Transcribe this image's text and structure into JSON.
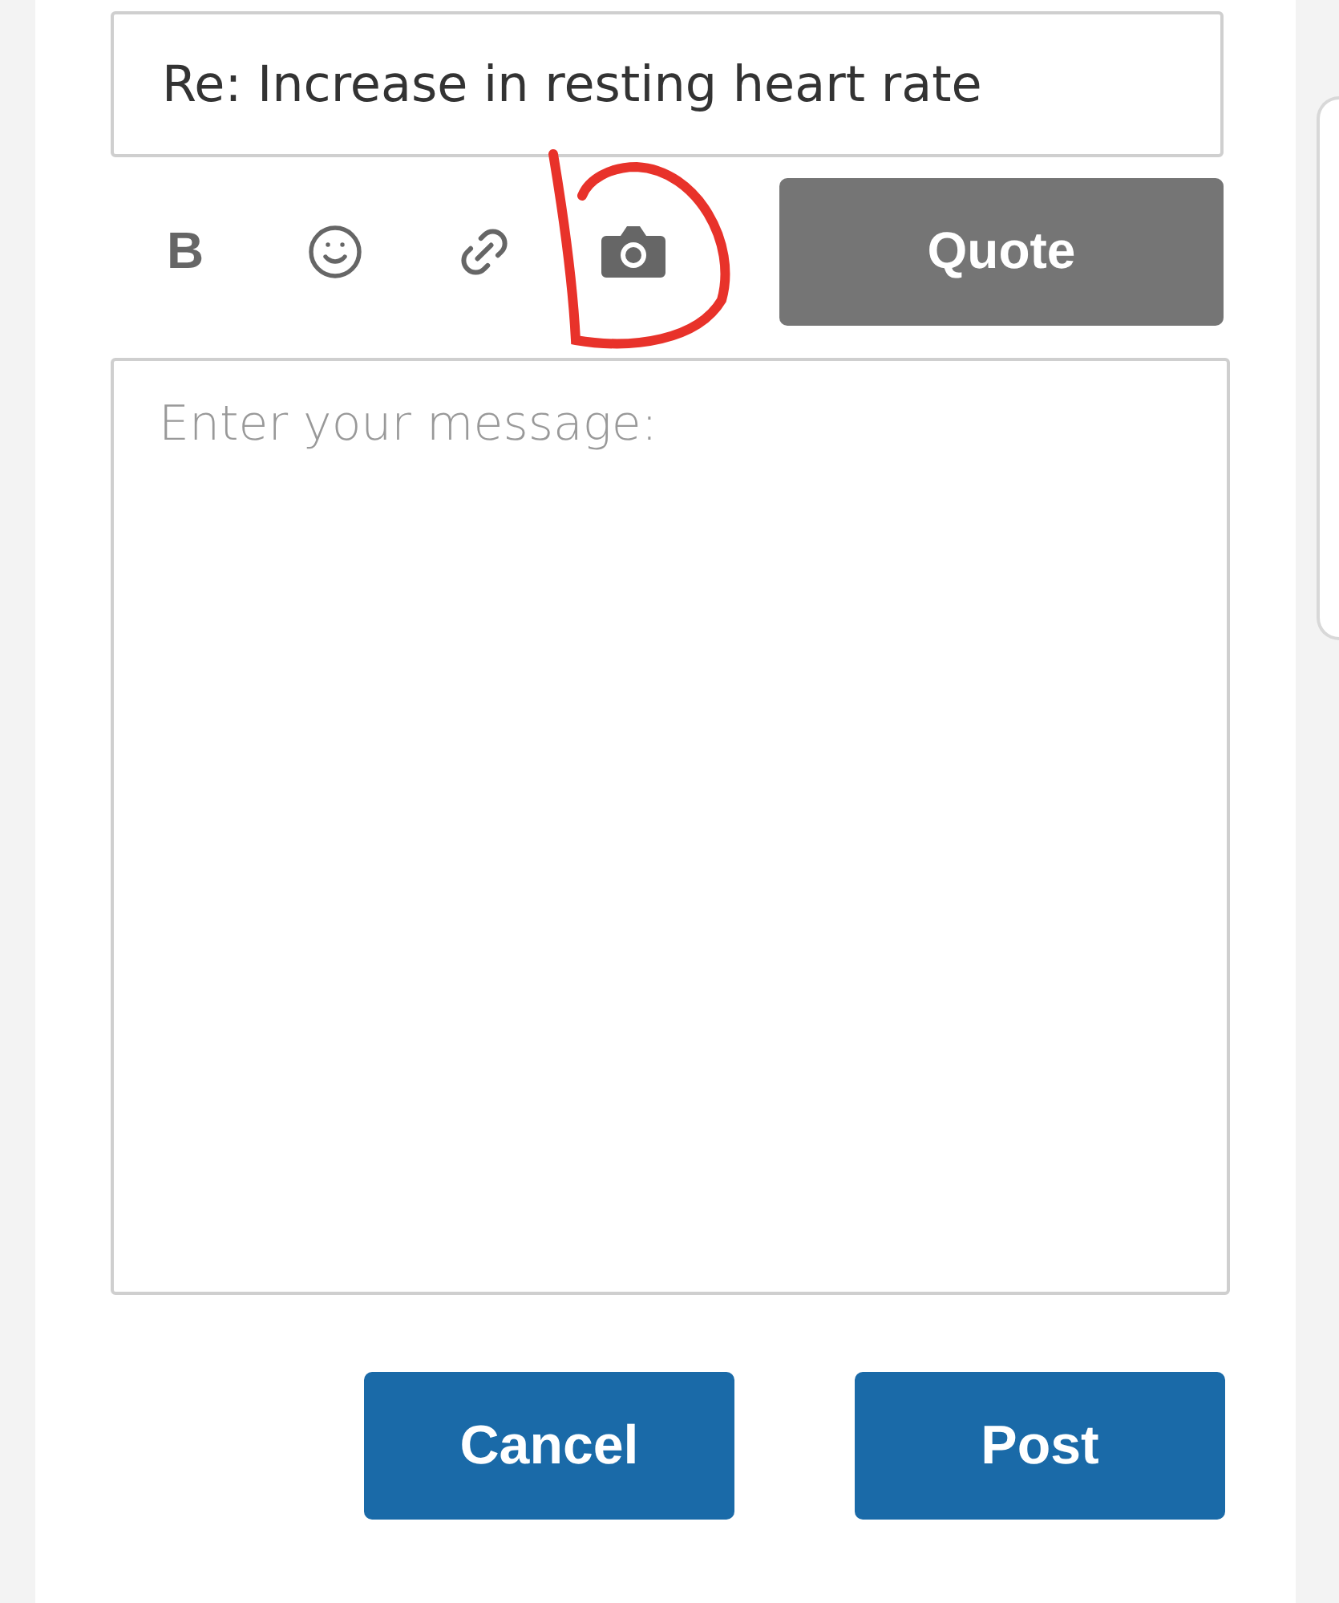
{
  "subject": {
    "value": "Re: Increase in resting heart rate"
  },
  "toolbar": [
    {
      "kind": "bold",
      "label": "B"
    },
    {
      "kind": "emoji"
    },
    {
      "kind": "link"
    },
    {
      "kind": "camera"
    }
  ],
  "quote_button": "Quote",
  "message": {
    "placeholder": "Enter your message:"
  },
  "buttons": [
    "Cancel",
    "Post"
  ]
}
